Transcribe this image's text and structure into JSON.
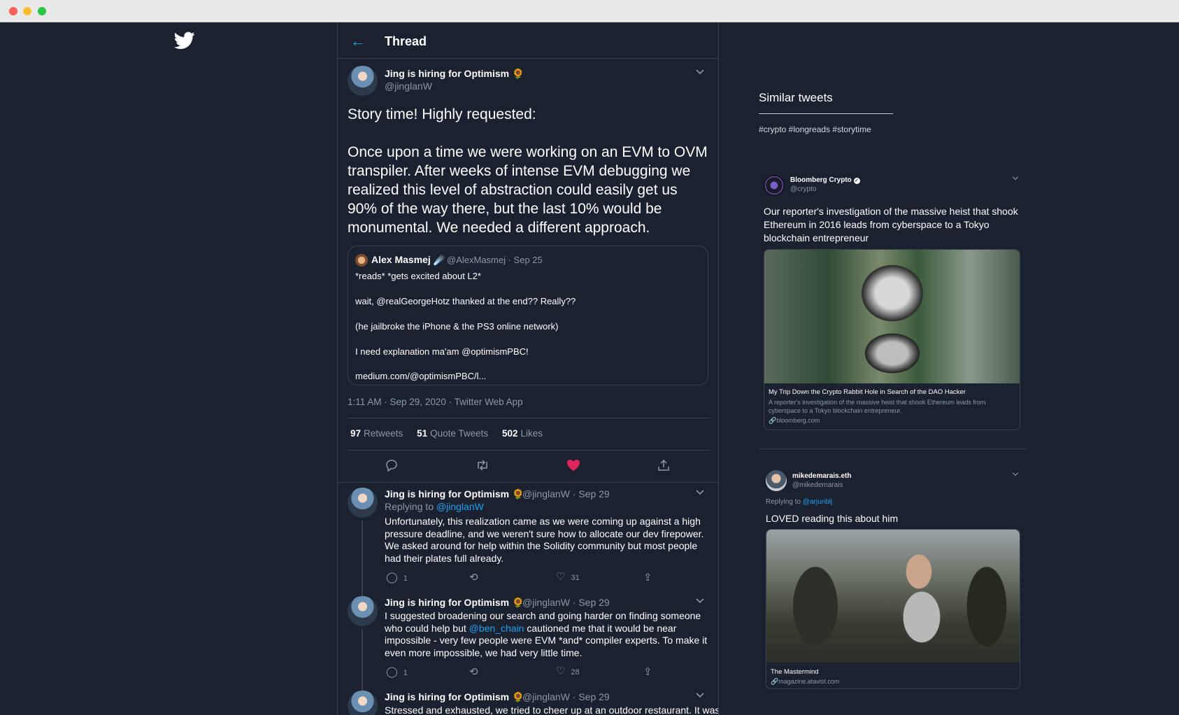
{
  "header": {
    "title": "Thread",
    "back_icon": "arrow-left-icon"
  },
  "main_tweet": {
    "name": "Jing is hiring for Optimism",
    "emoji": "🌻",
    "handle": "@jinglanW",
    "text": [
      "Story time! Highly requested:",
      "Once upon a time we were working on an EVM to OVM transpiler. After weeks of intense EVM debugging we realized this level of abstraction could easily get us 90% of the way there, but the last 10% would be monumental. We needed a different approach."
    ],
    "quote": {
      "name": "Alex Masmej",
      "emoji": "☄️",
      "meta": "@AlexMasmej · Sep 25",
      "lines": [
        "*reads* *gets excited about L2*",
        "wait, @realGeorgeHotz thanked at the end?? Really??",
        "(he jailbroke the iPhone & the PS3 online network)",
        "I need explanation ma'am @optimismPBC!",
        "medium.com/@optimismPBC/l..."
      ]
    },
    "timestamp": "1:11 AM · Sep 29, 2020 · Twitter Web App",
    "stats": {
      "retweets": "97",
      "retweets_label": "Retweets",
      "quotes": "51",
      "quotes_label": "Quote Tweets",
      "likes": "502",
      "likes_label": "Likes"
    },
    "colors": {
      "like": "#e0245e",
      "link": "#1da1f2"
    }
  },
  "replies": [
    {
      "name": "Jing is hiring for Optimism",
      "emoji": "🌻",
      "meta": "@jinglanW · Sep 29",
      "replying_label": "Replying to",
      "replying_to": "@jinglanW",
      "text": "Unfortunately, this realization came as we were coming up against a high pressure deadline, and we weren't sure how to allocate our dev firepower. We asked around for help within the Solidity community but most people had their plates full already.",
      "reply_count": "1",
      "like_count": "31"
    },
    {
      "name": "Jing is hiring for Optimism",
      "emoji": "🌻",
      "meta": "@jinglanW · Sep 29",
      "text_before": "I suggested broadening our search and going harder on finding someone who could help but ",
      "mention": "@ben_chain",
      "text_after": " cautioned me that it would be near impossible - very few people were EVM *and* compiler experts. To make it even more impossible, we had very little time.",
      "reply_count": "1",
      "like_count": "28"
    },
    {
      "name": "Jing is hiring for Optimism",
      "emoji": "🌻",
      "meta": "@jinglanW · Sep 29",
      "text": "Stressed and exhausted, we tried to cheer up at an outdoor restaurant. It was"
    }
  ],
  "sidebar": {
    "title": "Similar tweets",
    "tags": "#crypto #longreads #storytime",
    "cards": [
      {
        "name": "Bloomberg Crypto",
        "handle": "@crypto",
        "text": "Our reporter's investigation of the massive heist that shook Ethereum in 2016 leads from cyberspace to a Tokyo blockchain entrepreneur",
        "media_title": "My Trip Down the Crypto Rabbit Hole in Search of the DAO Hacker",
        "media_desc": "A reporter's investigation of the massive heist that shook Ethereum leads from cyberspace to a Tokyo blockchain entrepreneur.",
        "media_domain": "bloomberg.com"
      },
      {
        "name": "mikedemarais.eth",
        "handle": "@mikedemarais",
        "replying_label": "Replying to",
        "replying_to": "@arjunblj",
        "text": "LOVED reading this about him",
        "media_title": "The Mastermind",
        "media_domain": "magazine.atavist.com"
      }
    ]
  }
}
